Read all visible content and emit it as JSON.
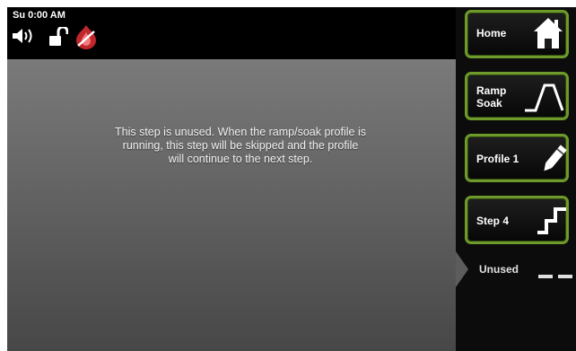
{
  "status_bar": {
    "clock": "Su 0:00 AM",
    "icons": [
      "speaker-icon",
      "unlock-icon",
      "alarm-flame-icon"
    ]
  },
  "main": {
    "message": "This step is unused.  When the ramp/soak profile is running, this step will be skipped and the profile will continue to the next step."
  },
  "sidebar": {
    "home": {
      "label": "Home",
      "icon": "home-icon"
    },
    "ramp_soak": {
      "label_line1": "Ramp",
      "label_line2": "Soak",
      "icon": "ramp-soak-icon"
    },
    "profile": {
      "label": "Profile 1",
      "icon": "pencil-icon"
    },
    "step": {
      "label": "Step  4",
      "icon": "step-icon"
    },
    "step_type": {
      "label": "Unused",
      "icon": "dash-line-icon"
    }
  },
  "colors": {
    "button_border": "#6d9a2a",
    "panel_top": "#7a7a7a",
    "panel_bottom": "#474747",
    "alarm": "#c0272d"
  }
}
